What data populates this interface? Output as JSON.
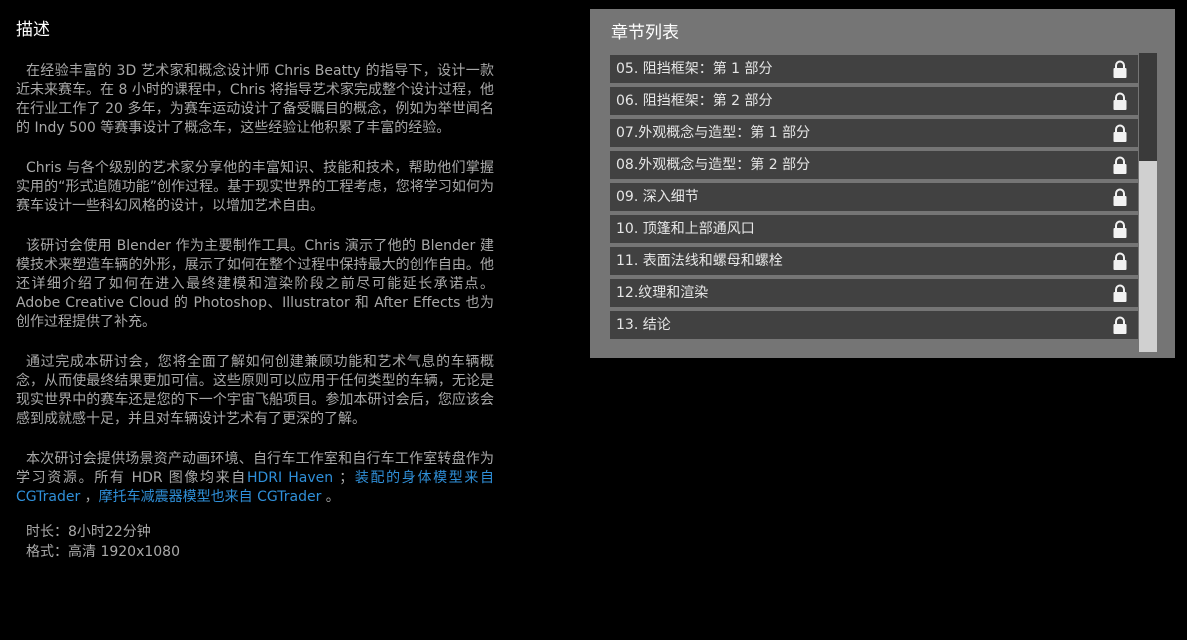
{
  "description": {
    "title": "描述",
    "paragraphs": [
      "在经验丰富的 3D 艺术家和概念设计师 Chris Beatty 的指导下，设计一款近未来赛车。在 8 小时的课程中，Chris 将指导艺术家完成整个设计过程，他在行业工作了 20 多年，为赛车运动设计了备受瞩目的概念，例如为举世闻名的 Indy 500 等赛事设计了概念车，这些经验让他积累了丰富的经验。",
      "Chris 与各个级别的艺术家分享他的丰富知识、技能和技术，帮助他们掌握实用的“形式追随功能”创作过程。基于现实世界的工程考虑，您将学习如何为赛车设计一些科幻风格的设计，以增加艺术自由。",
      "该研讨会使用 Blender 作为主要制作工具。Chris 演示了他的 Blender 建模技术来塑造车辆的外形，展示了如何在整个过程中保持最大的创作自由。他还详细介绍了如何在进入最终建模和渲染阶段之前尽可能延长承诺点。Adobe Creative Cloud 的 Photoshop、Illustrator 和 After Effects 也为创作过程提供了补充。",
      "通过完成本研讨会，您将全面了解如何创建兼顾功能和艺术气息的车辆概念，从而使最终结果更加可信。这些原则可以应用于任何类型的车辆，无论是现实世界中的赛车还是您的下一个宇宙飞船项目。参加本研讨会后，您应该会感到成就感十足，并且对车辆设计艺术有了更深的了解。"
    ],
    "resources": {
      "text_before": "本次研讨会提供场景资产动画环境、自行车工作室和自行车工作室转盘作为学习资源。所有 HDR 图像均来自",
      "link_hdri": "HDRI Haven",
      "sep1": " ；",
      "link_body": "装配的身体模型来自 CGTrader",
      "sep2": " ，",
      "link_moto": "摩托车减震器模型也来自 CGTrader",
      "end": " 。"
    },
    "duration": "时长：8小时22分钟",
    "format": "格式：高清 1920x1080"
  },
  "chapters": {
    "title": "章节列表",
    "lock_icon": "lock-icon",
    "items": [
      "05. 阻挡框架：第 1 部分",
      "06. 阻挡框架：第 2 部分",
      "07.外观概念与造型：第 1 部分",
      "08.外观概念与造型：第 2 部分",
      "09. 深入细节",
      "10. 顶篷和上部通风口",
      "11. 表面法线和螺母和螺栓",
      "12.纹理和渲染",
      "13. 结论"
    ]
  }
}
